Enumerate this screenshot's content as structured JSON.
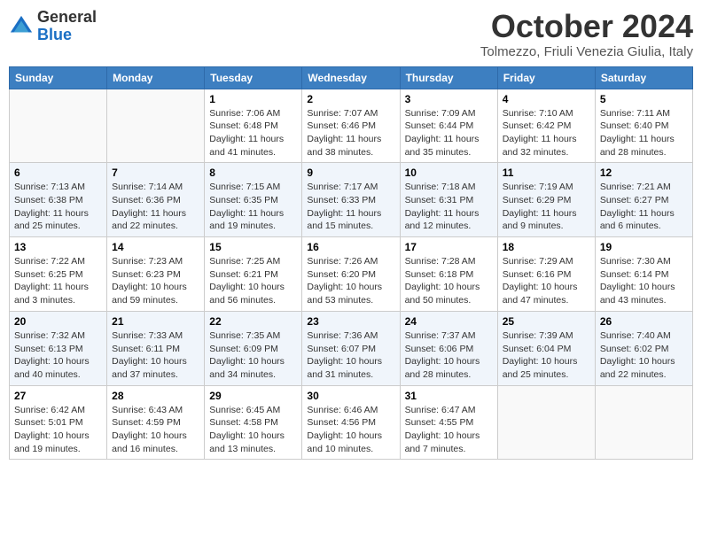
{
  "header": {
    "logo_line1": "General",
    "logo_line2": "Blue",
    "month_title": "October 2024",
    "location": "Tolmezzo, Friuli Venezia Giulia, Italy"
  },
  "weekdays": [
    "Sunday",
    "Monday",
    "Tuesday",
    "Wednesday",
    "Thursday",
    "Friday",
    "Saturday"
  ],
  "weeks": [
    [
      {
        "day": "",
        "info": ""
      },
      {
        "day": "",
        "info": ""
      },
      {
        "day": "1",
        "info": "Sunrise: 7:06 AM\nSunset: 6:48 PM\nDaylight: 11 hours and 41 minutes."
      },
      {
        "day": "2",
        "info": "Sunrise: 7:07 AM\nSunset: 6:46 PM\nDaylight: 11 hours and 38 minutes."
      },
      {
        "day": "3",
        "info": "Sunrise: 7:09 AM\nSunset: 6:44 PM\nDaylight: 11 hours and 35 minutes."
      },
      {
        "day": "4",
        "info": "Sunrise: 7:10 AM\nSunset: 6:42 PM\nDaylight: 11 hours and 32 minutes."
      },
      {
        "day": "5",
        "info": "Sunrise: 7:11 AM\nSunset: 6:40 PM\nDaylight: 11 hours and 28 minutes."
      }
    ],
    [
      {
        "day": "6",
        "info": "Sunrise: 7:13 AM\nSunset: 6:38 PM\nDaylight: 11 hours and 25 minutes."
      },
      {
        "day": "7",
        "info": "Sunrise: 7:14 AM\nSunset: 6:36 PM\nDaylight: 11 hours and 22 minutes."
      },
      {
        "day": "8",
        "info": "Sunrise: 7:15 AM\nSunset: 6:35 PM\nDaylight: 11 hours and 19 minutes."
      },
      {
        "day": "9",
        "info": "Sunrise: 7:17 AM\nSunset: 6:33 PM\nDaylight: 11 hours and 15 minutes."
      },
      {
        "day": "10",
        "info": "Sunrise: 7:18 AM\nSunset: 6:31 PM\nDaylight: 11 hours and 12 minutes."
      },
      {
        "day": "11",
        "info": "Sunrise: 7:19 AM\nSunset: 6:29 PM\nDaylight: 11 hours and 9 minutes."
      },
      {
        "day": "12",
        "info": "Sunrise: 7:21 AM\nSunset: 6:27 PM\nDaylight: 11 hours and 6 minutes."
      }
    ],
    [
      {
        "day": "13",
        "info": "Sunrise: 7:22 AM\nSunset: 6:25 PM\nDaylight: 11 hours and 3 minutes."
      },
      {
        "day": "14",
        "info": "Sunrise: 7:23 AM\nSunset: 6:23 PM\nDaylight: 10 hours and 59 minutes."
      },
      {
        "day": "15",
        "info": "Sunrise: 7:25 AM\nSunset: 6:21 PM\nDaylight: 10 hours and 56 minutes."
      },
      {
        "day": "16",
        "info": "Sunrise: 7:26 AM\nSunset: 6:20 PM\nDaylight: 10 hours and 53 minutes."
      },
      {
        "day": "17",
        "info": "Sunrise: 7:28 AM\nSunset: 6:18 PM\nDaylight: 10 hours and 50 minutes."
      },
      {
        "day": "18",
        "info": "Sunrise: 7:29 AM\nSunset: 6:16 PM\nDaylight: 10 hours and 47 minutes."
      },
      {
        "day": "19",
        "info": "Sunrise: 7:30 AM\nSunset: 6:14 PM\nDaylight: 10 hours and 43 minutes."
      }
    ],
    [
      {
        "day": "20",
        "info": "Sunrise: 7:32 AM\nSunset: 6:13 PM\nDaylight: 10 hours and 40 minutes."
      },
      {
        "day": "21",
        "info": "Sunrise: 7:33 AM\nSunset: 6:11 PM\nDaylight: 10 hours and 37 minutes."
      },
      {
        "day": "22",
        "info": "Sunrise: 7:35 AM\nSunset: 6:09 PM\nDaylight: 10 hours and 34 minutes."
      },
      {
        "day": "23",
        "info": "Sunrise: 7:36 AM\nSunset: 6:07 PM\nDaylight: 10 hours and 31 minutes."
      },
      {
        "day": "24",
        "info": "Sunrise: 7:37 AM\nSunset: 6:06 PM\nDaylight: 10 hours and 28 minutes."
      },
      {
        "day": "25",
        "info": "Sunrise: 7:39 AM\nSunset: 6:04 PM\nDaylight: 10 hours and 25 minutes."
      },
      {
        "day": "26",
        "info": "Sunrise: 7:40 AM\nSunset: 6:02 PM\nDaylight: 10 hours and 22 minutes."
      }
    ],
    [
      {
        "day": "27",
        "info": "Sunrise: 6:42 AM\nSunset: 5:01 PM\nDaylight: 10 hours and 19 minutes."
      },
      {
        "day": "28",
        "info": "Sunrise: 6:43 AM\nSunset: 4:59 PM\nDaylight: 10 hours and 16 minutes."
      },
      {
        "day": "29",
        "info": "Sunrise: 6:45 AM\nSunset: 4:58 PM\nDaylight: 10 hours and 13 minutes."
      },
      {
        "day": "30",
        "info": "Sunrise: 6:46 AM\nSunset: 4:56 PM\nDaylight: 10 hours and 10 minutes."
      },
      {
        "day": "31",
        "info": "Sunrise: 6:47 AM\nSunset: 4:55 PM\nDaylight: 10 hours and 7 minutes."
      },
      {
        "day": "",
        "info": ""
      },
      {
        "day": "",
        "info": ""
      }
    ]
  ]
}
